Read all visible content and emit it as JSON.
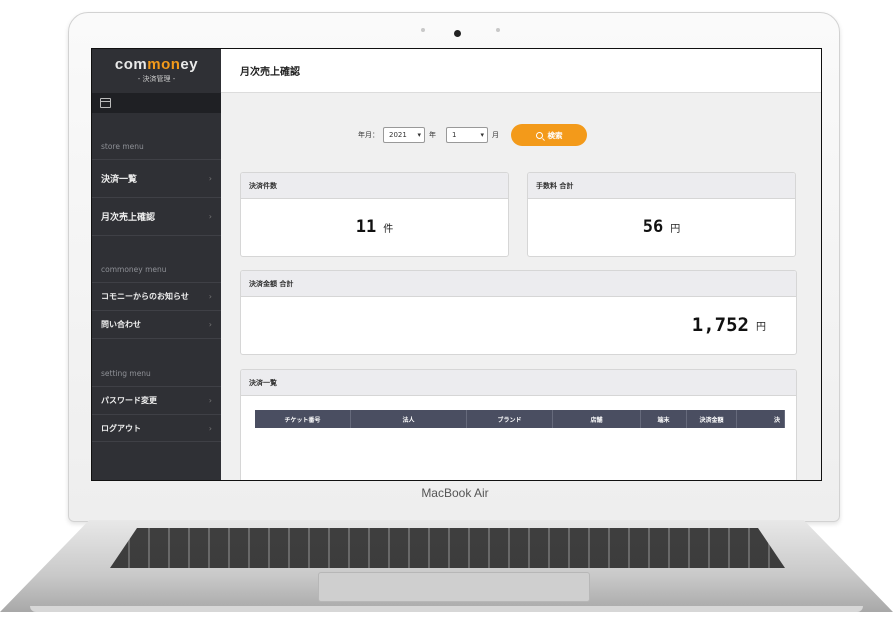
{
  "device": {
    "brand_label": "MacBook Air"
  },
  "logo": {
    "main_a": "com",
    "main_b": "mon",
    "main_c": "ey",
    "subtitle": "- 決済管理 -"
  },
  "sidebar": {
    "sections": [
      {
        "header": "store menu",
        "items": [
          {
            "label": "決済一覧"
          },
          {
            "label": "月次売上確認"
          }
        ]
      },
      {
        "header": "commoney menu",
        "items": [
          {
            "label": "コモニーからのお知らせ"
          },
          {
            "label": "問い合わせ"
          }
        ]
      },
      {
        "header": "setting menu",
        "items": [
          {
            "label": "パスワード変更"
          },
          {
            "label": "ログアウト"
          }
        ]
      }
    ],
    "chevron": "›"
  },
  "header": {
    "title": "月次売上確認"
  },
  "filter": {
    "label": "年月：",
    "year_value": "2021",
    "year_unit": "年",
    "month_value": "1",
    "month_unit": "月",
    "search_label": "検索"
  },
  "cards": {
    "count": {
      "title": "決済件数",
      "value": "11",
      "unit": "件"
    },
    "fee": {
      "title": "手数料 合計",
      "value": "56",
      "unit": "円"
    },
    "amount": {
      "title": "決済金額 合計",
      "value": "1,752",
      "unit": "円"
    },
    "list": {
      "title": "決済一覧",
      "columns": [
        "チケット番号",
        "法人",
        "ブランド",
        "店舗",
        "端末",
        "決済金額",
        "決"
      ]
    }
  },
  "colors": {
    "accent": "#f39a1a",
    "sidebar_bg": "#2f3035",
    "table_header": "#4a4e61"
  }
}
